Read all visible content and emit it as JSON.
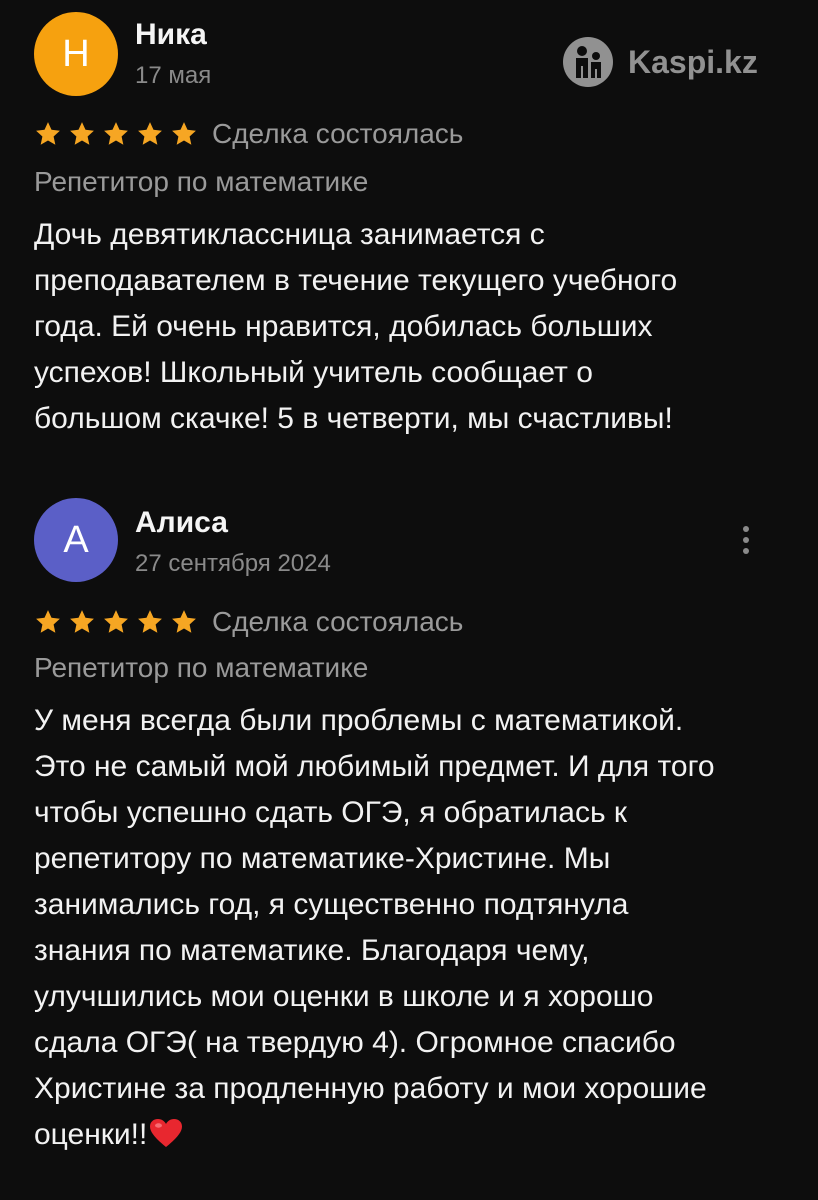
{
  "watermark": {
    "text": "Kaspi.kz",
    "icon": "kaspi-logo-icon"
  },
  "colors": {
    "background": "#0d0d0d",
    "star": "#f6a623",
    "avatar_nika": "#f6a10f",
    "avatar_alisa": "#5b5fc7",
    "muted_text": "#9a9a9a"
  },
  "reviews": [
    {
      "avatar_letter": "Н",
      "author": "Ника",
      "date": "17 мая",
      "rating": 5,
      "status": "Сделка состоялась",
      "category": "Репетитор по математике",
      "text_lines": [
        "Дочь девятиклассница занимается с",
        "преподавателем в течение текущего учебного",
        "года.  Ей очень нравится, добилась больших",
        "успехов! Школьный учитель сообщает о",
        "большом скачке! 5 в четверти, мы счастливы!"
      ]
    },
    {
      "avatar_letter": "А",
      "author": "Алиса",
      "date": "27 сентября 2024",
      "rating": 5,
      "status": "Сделка состоялась",
      "category": "Репетитор по математике",
      "text_lines": [
        "У меня всегда были проблемы с математикой.",
        "Это не самый мой любимый предмет. И для того",
        "чтобы успешно сдать ОГЭ, я обратилась к",
        "репетитору по математике-Христине. Мы",
        "занимались год, я существенно подтянула",
        "знания по математике. Благодаря чему,",
        "улучшились мои оценки в школе и я хорошо",
        "сдала ОГЭ( на твердую 4). Огромное спасибо",
        "Христине за продленную работу и мои хорошие",
        "оценки!!"
      ],
      "trailing_emoji": "red-heart-icon"
    }
  ]
}
